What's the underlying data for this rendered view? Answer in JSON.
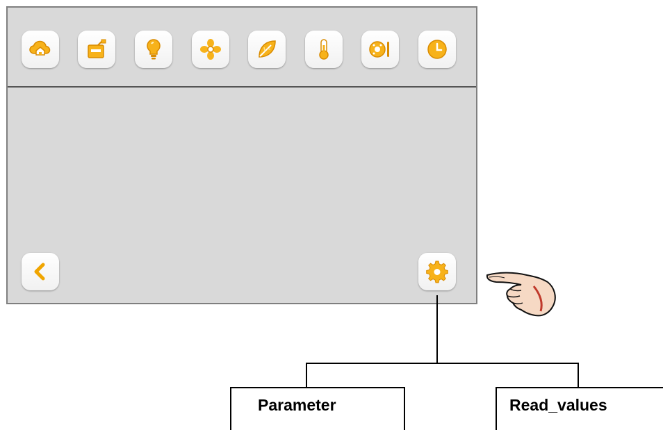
{
  "screen": {
    "top_icons": [
      {
        "icon": "cloud-home-icon"
      },
      {
        "icon": "tv-schedule-icon"
      },
      {
        "icon": "lightbulb-icon"
      },
      {
        "icon": "fan-icon"
      },
      {
        "icon": "leaf-icon"
      },
      {
        "icon": "thermometer-icon"
      },
      {
        "icon": "dial-slider-icon"
      },
      {
        "icon": "clock-icon"
      }
    ],
    "back_button": {
      "icon": "chevron-left-icon"
    },
    "settings_button": {
      "icon": "gear-icon"
    }
  },
  "menu": {
    "parameter_label": "Parameter",
    "read_values_label": "Read_values"
  },
  "colors": {
    "screen_bg": "#d9d9d9",
    "icon_accent": "#f0a500",
    "icon_accent_light": "#ffd15c",
    "button_bg": "#ffffff"
  }
}
